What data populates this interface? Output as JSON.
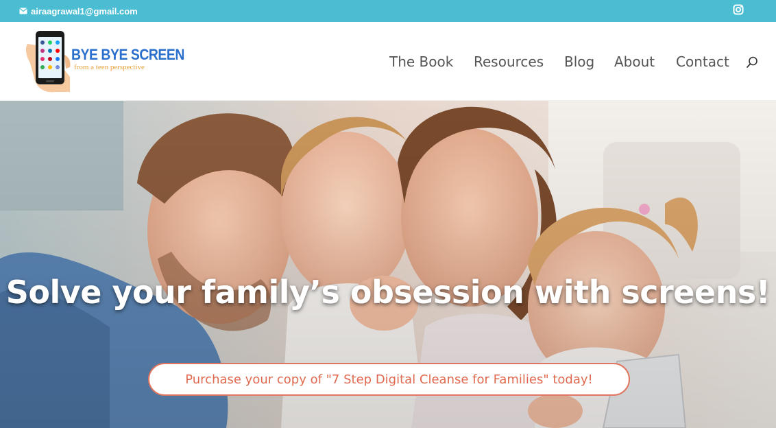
{
  "topbar": {
    "email": "airaagrawal1@gmail.com",
    "email_icon": "envelope-icon",
    "social_icon": "instagram-icon",
    "background": "#4bbdd3"
  },
  "logo": {
    "title": "BYE BYE SCREEN",
    "tagline": "from a teen perspective"
  },
  "nav": {
    "items": [
      {
        "label": "The Book"
      },
      {
        "label": "Resources"
      },
      {
        "label": "Blog"
      },
      {
        "label": "About"
      },
      {
        "label": "Contact"
      }
    ],
    "search_icon": "search-icon"
  },
  "hero": {
    "headline": "Solve your family’s obsession with screens!",
    "cta_label": "Purchase your copy of \"7 Step Digital Cleanse for Families\" today!",
    "accent": "#e07660"
  }
}
